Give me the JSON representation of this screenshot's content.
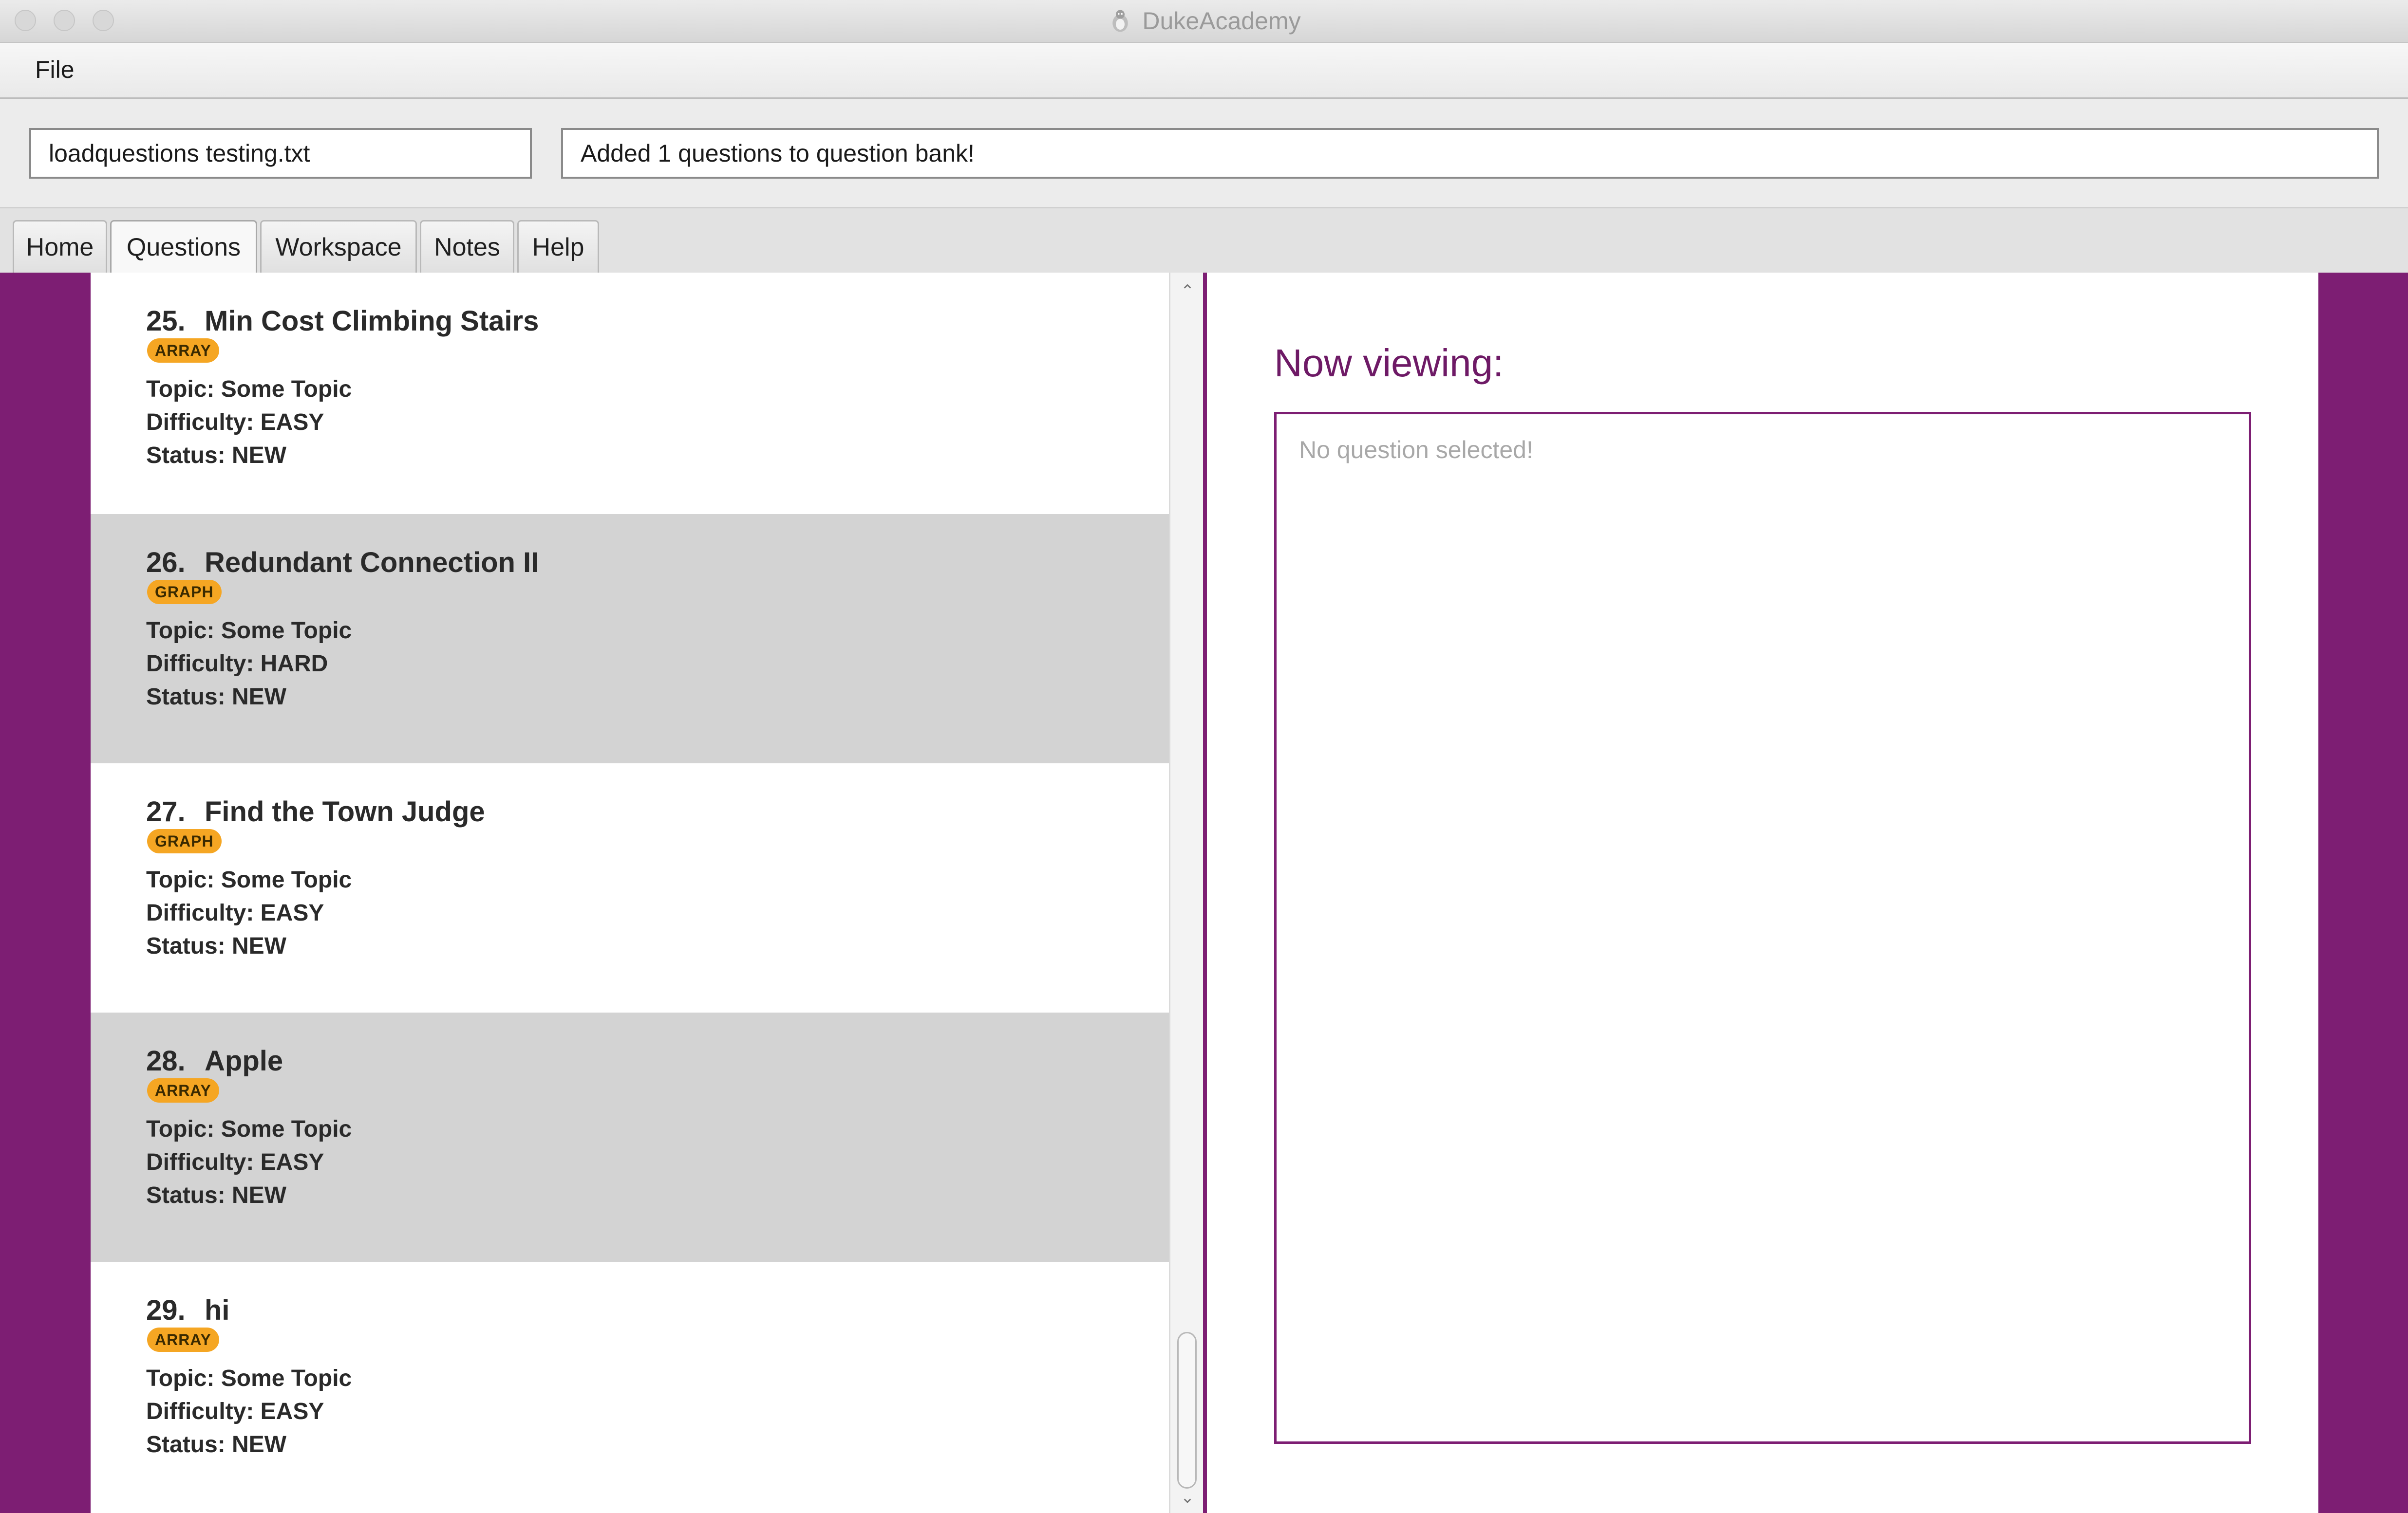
{
  "window": {
    "title": "DukeAcademy"
  },
  "menu": {
    "items": [
      {
        "label": "File"
      }
    ]
  },
  "command": {
    "input_value": "loadquestions testing.txt",
    "result_text": "Added 1 questions to question bank!"
  },
  "tabs": [
    {
      "label": "Home"
    },
    {
      "label": "Questions"
    },
    {
      "label": "Workspace"
    },
    {
      "label": "Notes"
    },
    {
      "label": "Help"
    }
  ],
  "selected_tab": "Questions",
  "questions": [
    {
      "number": "25.",
      "title": "Min Cost Climbing Stairs",
      "tag": "ARRAY",
      "topic": "Topic: Some Topic",
      "difficulty": "Difficulty: EASY",
      "status": "Status: NEW"
    },
    {
      "number": "26.",
      "title": "Redundant Connection II",
      "tag": "GRAPH",
      "topic": "Topic: Some Topic",
      "difficulty": "Difficulty: HARD",
      "status": "Status: NEW"
    },
    {
      "number": "27.",
      "title": "Find the Town Judge",
      "tag": "GRAPH",
      "topic": "Topic: Some Topic",
      "difficulty": "Difficulty: EASY",
      "status": "Status: NEW"
    },
    {
      "number": "28.",
      "title": "Apple",
      "tag": "ARRAY",
      "topic": "Topic: Some Topic",
      "difficulty": "Difficulty: EASY",
      "status": "Status: NEW"
    },
    {
      "number": "29.",
      "title": "hi",
      "tag": "ARRAY",
      "topic": "Topic: Some Topic",
      "difficulty": "Difficulty: EASY",
      "status": "Status: NEW"
    }
  ],
  "detail": {
    "heading": "Now viewing:",
    "placeholder": "No question selected!"
  },
  "colors": {
    "accent": "#7d1e73",
    "tag": "#f5a623",
    "alt_row": "#d3d3d3"
  },
  "icons": {
    "app": "duke-penguin-icon",
    "scroll_up": "chevron-up-icon",
    "scroll_down": "chevron-down-icon"
  }
}
